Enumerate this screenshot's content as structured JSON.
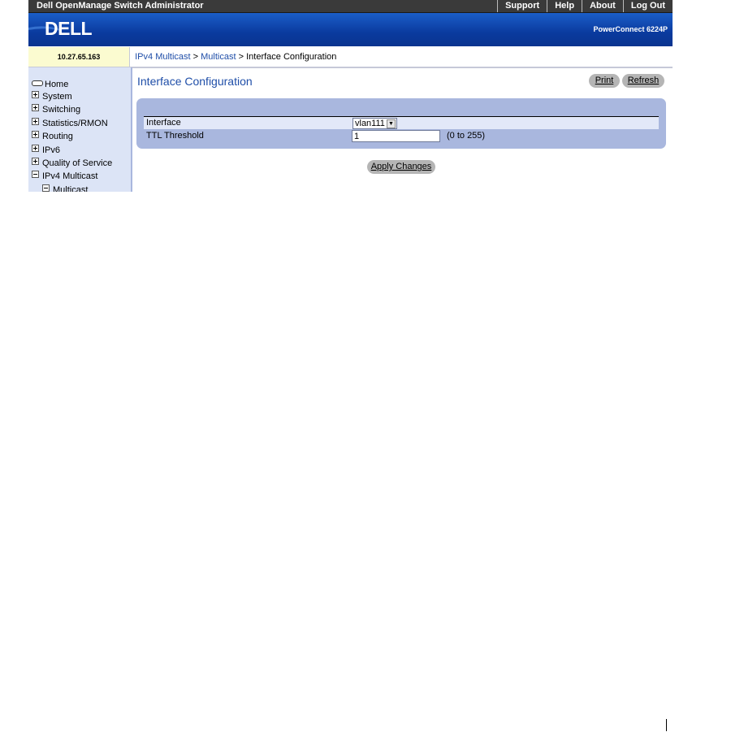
{
  "app": {
    "title": "Dell OpenManage Switch Administrator",
    "top_links": [
      "Support",
      "Help",
      "About",
      "Log Out"
    ],
    "logo": "DELL",
    "model": "PowerConnect 6224P"
  },
  "ip_address": "10.27.65.163",
  "breadcrumb": {
    "items": [
      "IPv4 Multicast",
      "Multicast",
      "Interface Configuration"
    ],
    "separator": " > "
  },
  "sidebar": {
    "home": "Home",
    "items": [
      {
        "label": "System",
        "state": "collapsed"
      },
      {
        "label": "Switching",
        "state": "collapsed"
      },
      {
        "label": "Statistics/RMON",
        "state": "collapsed"
      },
      {
        "label": "Routing",
        "state": "collapsed"
      },
      {
        "label": "IPv6",
        "state": "collapsed"
      },
      {
        "label": "Quality of Service",
        "state": "collapsed"
      },
      {
        "label": "IPv4 Multicast",
        "state": "expanded"
      },
      {
        "label": "Multicast",
        "state": "expanded"
      }
    ]
  },
  "page": {
    "title": "Interface Configuration",
    "print_label": "Print",
    "refresh_label": "Refresh",
    "fields": {
      "interface_label": "Interface",
      "interface_value": "vlan111",
      "ttl_label": "TTL Threshold",
      "ttl_value": "1",
      "ttl_range": "(0 to 255)"
    },
    "apply_label": "Apply Changes"
  },
  "colors": {
    "topbar": "#3a3a3a",
    "banner": "#0a3a9e",
    "link": "#1f4ea8",
    "sidebar_bg": "#dce4f6",
    "panel_bg": "#a9b7de",
    "ip_bg": "#fbfbd0",
    "button_bg": "#b5b5b5"
  },
  "icons": {
    "expand": "plus-box-icon",
    "collapse": "minus-box-icon",
    "home": "home-icon",
    "dropdown": "chevron-down-icon"
  }
}
